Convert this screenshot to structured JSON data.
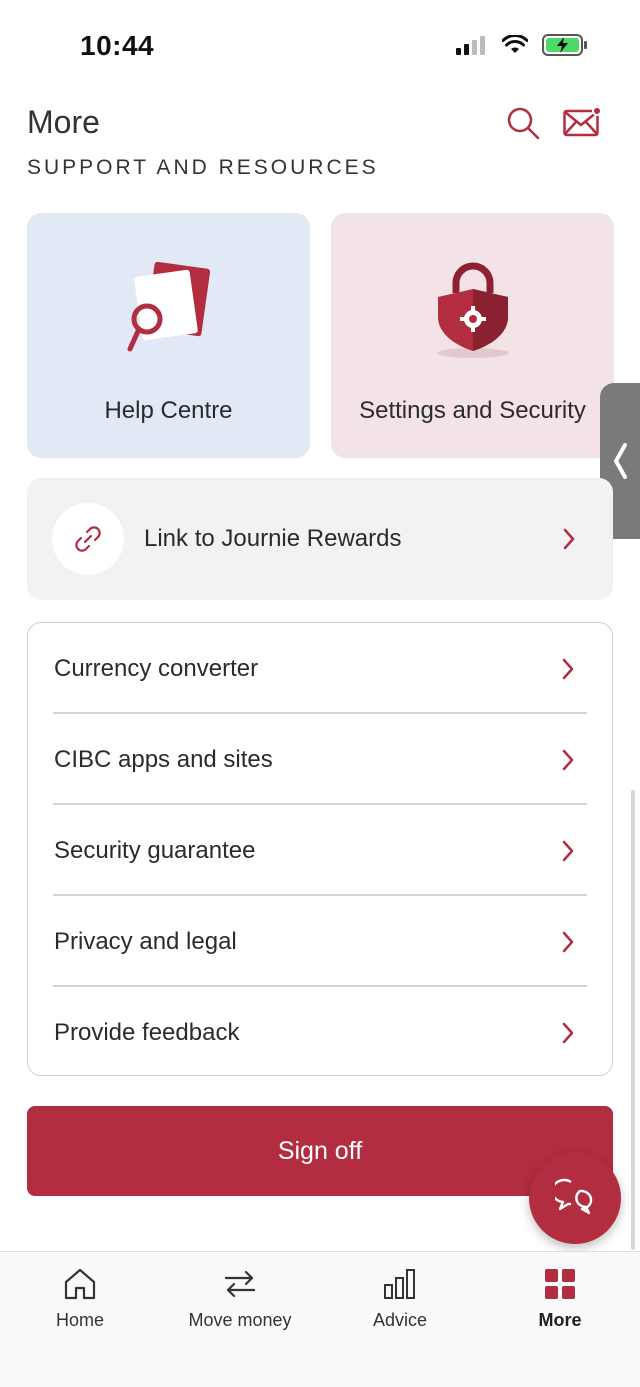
{
  "status_bar": {
    "time": "10:44"
  },
  "header": {
    "title": "More",
    "search_icon": "search-icon",
    "mail_icon": "mail-icon"
  },
  "section": {
    "heading": "SUPPORT AND RESOURCES"
  },
  "tiles": [
    {
      "label": "Help Centre",
      "icon": "help-document-icon"
    },
    {
      "label": "Settings and Security",
      "icon": "shield-lock-icon"
    }
  ],
  "rewards": {
    "label": "Link to Journie Rewards",
    "icon": "link-icon"
  },
  "list_items": [
    {
      "label": "Currency converter"
    },
    {
      "label": "CIBC apps and sites"
    },
    {
      "label": "Security guarantee"
    },
    {
      "label": "Privacy and legal"
    },
    {
      "label": "Provide feedback"
    }
  ],
  "signoff": {
    "label": "Sign off"
  },
  "bottom_nav": [
    {
      "label": "Home",
      "icon": "home-icon"
    },
    {
      "label": "Move money",
      "icon": "transfer-icon"
    },
    {
      "label": "Advice",
      "icon": "chart-icon"
    },
    {
      "label": "More",
      "icon": "grid-icon",
      "active": true
    }
  ],
  "colors": {
    "brand": "#b22d40",
    "help_tile": "#e0e9f5",
    "settings_tile": "#f3e3e7"
  }
}
